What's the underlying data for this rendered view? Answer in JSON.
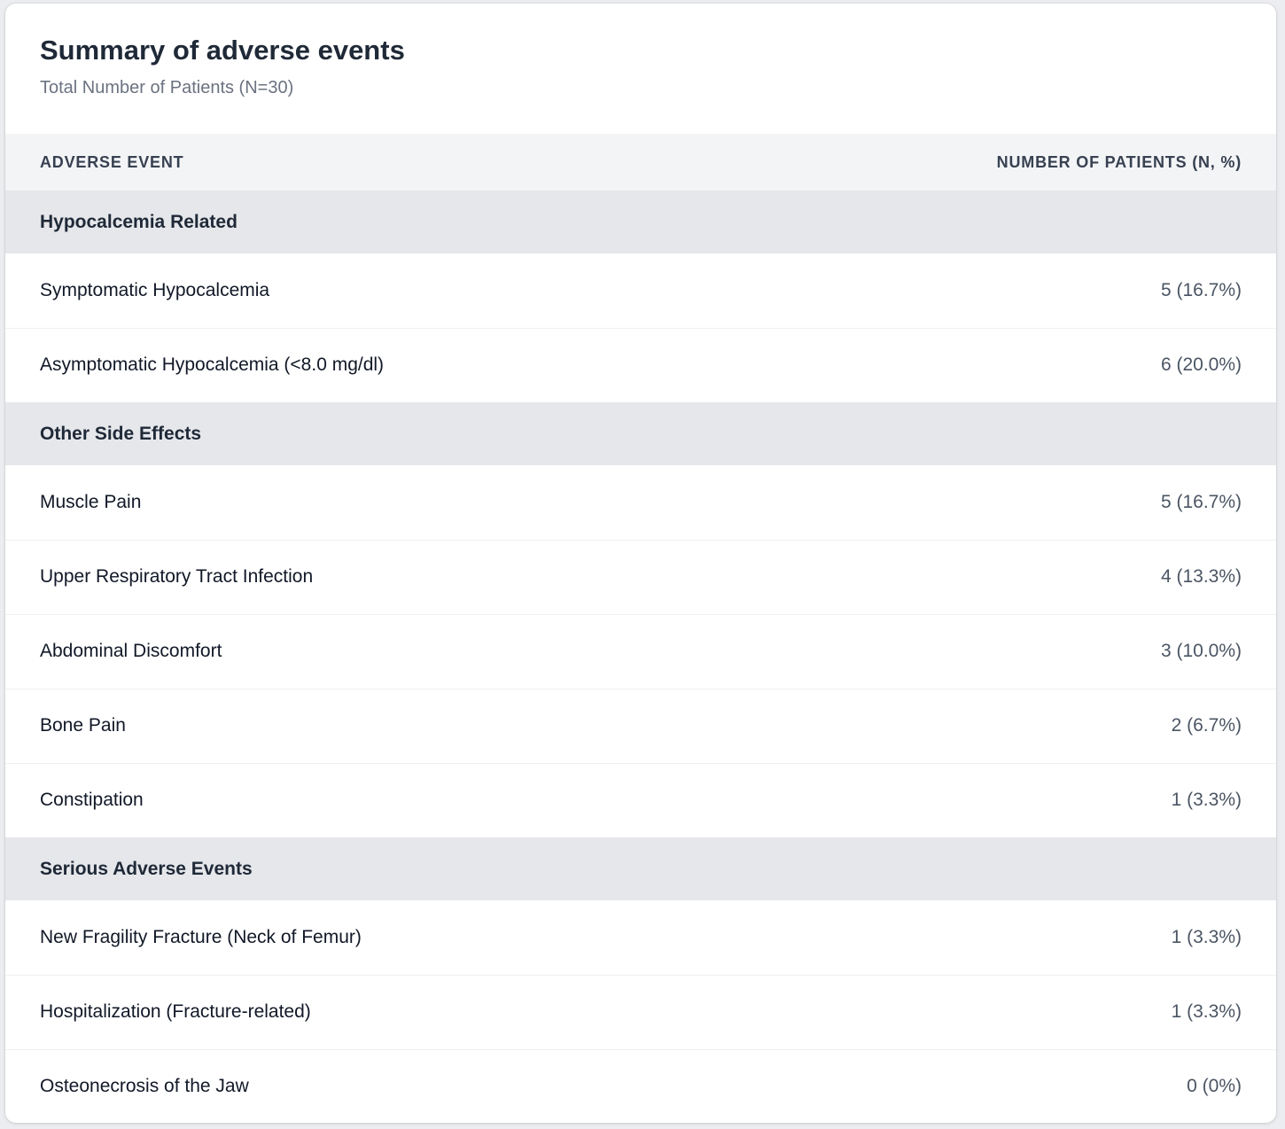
{
  "header": {
    "title": "Summary of adverse events",
    "subtitle": "Total Number of Patients (N=30)"
  },
  "table": {
    "columns": [
      "Adverse Event",
      "Number of Patients (n, %)"
    ],
    "groups": [
      {
        "name": "Hypocalcemia Related",
        "rows": [
          {
            "event": "Symptomatic Hypocalcemia",
            "count": "5 (16.7%)"
          },
          {
            "event": "Asymptomatic Hypocalcemia (<8.0 mg/dl)",
            "count": "6 (20.0%)"
          }
        ]
      },
      {
        "name": "Other Side Effects",
        "rows": [
          {
            "event": "Muscle Pain",
            "count": "5 (16.7%)"
          },
          {
            "event": "Upper Respiratory Tract Infection",
            "count": "4 (13.3%)"
          },
          {
            "event": "Abdominal Discomfort",
            "count": "3 (10.0%)"
          },
          {
            "event": "Bone Pain",
            "count": "2 (6.7%)"
          },
          {
            "event": "Constipation",
            "count": "1 (3.3%)"
          }
        ]
      },
      {
        "name": "Serious Adverse Events",
        "rows": [
          {
            "event": "New Fragility Fracture (Neck of Femur)",
            "count": "1 (3.3%)"
          },
          {
            "event": "Hospitalization (Fracture-related)",
            "count": "1 (3.3%)"
          },
          {
            "event": "Osteonecrosis of the Jaw",
            "count": "0 (0%)"
          }
        ]
      }
    ]
  }
}
